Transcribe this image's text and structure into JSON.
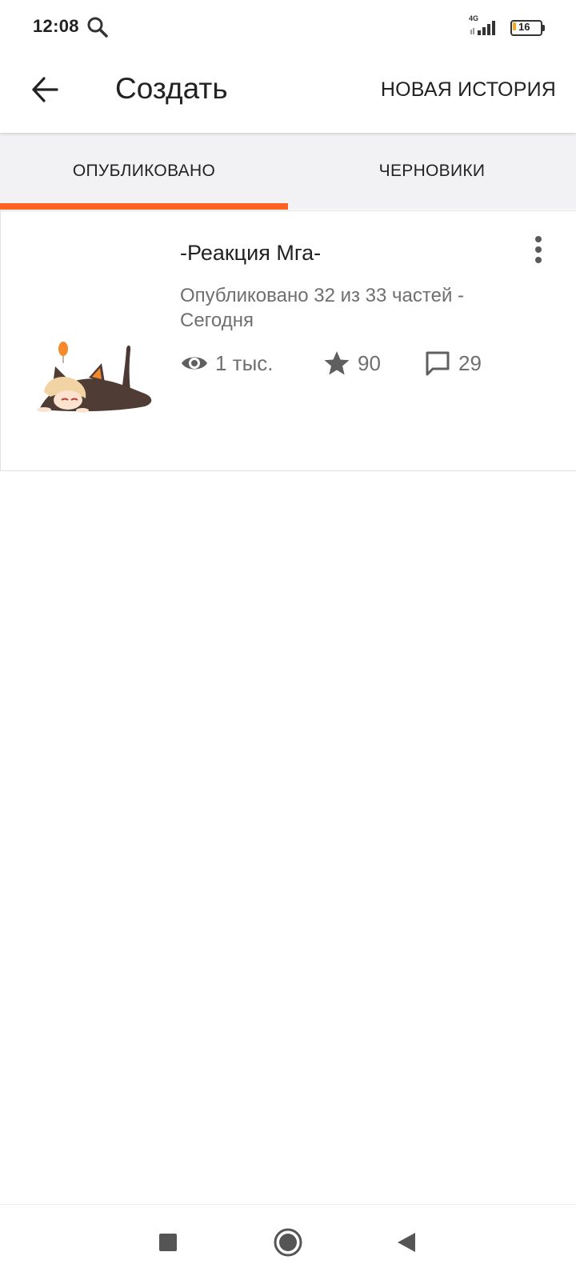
{
  "status_bar": {
    "time": "12:08",
    "network_label": "4G",
    "battery_level": "16",
    "icons": [
      "search-icon",
      "signal-icon",
      "battery-icon"
    ]
  },
  "app_bar": {
    "title": "Создать",
    "action_label": "НОВАЯ ИСТОРИЯ",
    "back_icon": "arrow-left-icon"
  },
  "tabs": [
    {
      "label": "ОПУБЛИКОВАНО",
      "selected": true
    },
    {
      "label": "ЧЕРНОВИКИ",
      "selected": false
    }
  ],
  "story": {
    "title": "-Реакция Мга-",
    "meta": "Опубликовано 32 из 33 частей - Сегодня",
    "reads": "1 тыс.",
    "votes": "90",
    "comments": "29",
    "icons": [
      "eye-icon",
      "star-icon",
      "comment-icon",
      "more-vertical-icon"
    ]
  },
  "nav_bar": {
    "icons": [
      "square-icon",
      "circle-icon",
      "triangle-back-icon"
    ]
  },
  "colors": {
    "accent": "#ff6122",
    "text_primary": "#222222",
    "text_secondary": "#6f6f6f",
    "tab_background": "#f2f2f4"
  }
}
